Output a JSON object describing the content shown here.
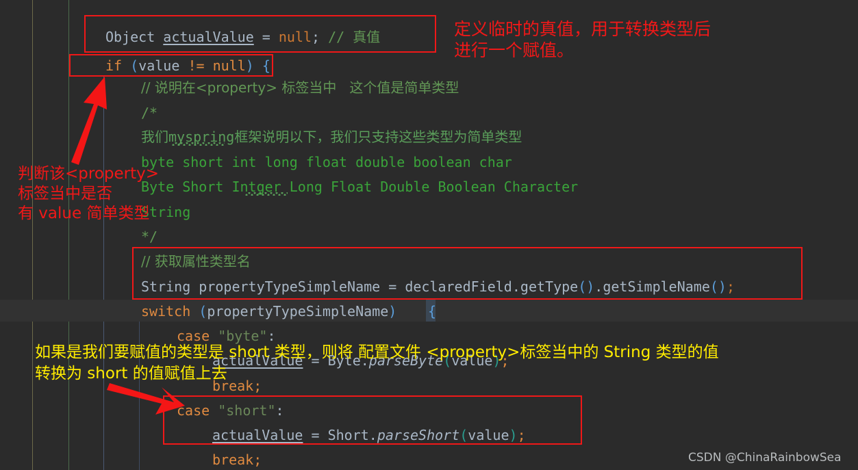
{
  "editor": {
    "background_color": "#2b2b2b",
    "current_line_color": "#323232",
    "code_lines": [
      {
        "id": "l1",
        "text": "Object actualValue = null; // 真值"
      },
      {
        "id": "l2",
        "text": "if (value != null) {"
      },
      {
        "id": "l3",
        "text": "// 说明在<property> 标签当中   这个值是简单类型"
      },
      {
        "id": "l4",
        "text": "/*"
      },
      {
        "id": "l5",
        "text": "我们myspring框架说明以下，我们只支持这些类型为简单类型"
      },
      {
        "id": "l6",
        "text": "byte short int long float double boolean char"
      },
      {
        "id": "l7",
        "text": "Byte Short Intger Long Float Double Boolean Character"
      },
      {
        "id": "l8",
        "text": "String"
      },
      {
        "id": "l9",
        "text": "*/"
      },
      {
        "id": "l10",
        "text": "// 获取属性类型名"
      },
      {
        "id": "l11",
        "text": "String propertyTypeSimpleName = declaredField.getType().getSimpleName();"
      },
      {
        "id": "l12",
        "text": "switch (propertyTypeSimpleName) {"
      },
      {
        "id": "l13",
        "text": "case \"byte\":"
      },
      {
        "id": "l14",
        "text": "actualValue = Byte.parseByte(value);"
      },
      {
        "id": "l15",
        "text": "break;"
      },
      {
        "id": "l16",
        "text": "case \"short\":"
      },
      {
        "id": "l17",
        "text": "actualValue = Short.parseShort(value);"
      },
      {
        "id": "l18",
        "text": "break;"
      }
    ],
    "tokens": {
      "t_object": "Object",
      "t_actualValue": "actualValue",
      "t_eq": " = ",
      "t_null": "null",
      "t_semi": ";",
      "t_comment_zhenzhi": " // 真值",
      "t_if": "if",
      "t_paren_open": " (",
      "t_value": "value",
      "t_neq": " != ",
      "t_paren_close": ")",
      "t_brace_open": " {",
      "t_switch": "switch",
      "t_case": "case",
      "t_str_byte": "\"byte\"",
      "t_str_short": "\"short\"",
      "t_colon": ":",
      "t_break": "break",
      "t_String": "String",
      "t_propTypeSimpleName": " propertyTypeSimpleName",
      "t_declaredField": "declaredField",
      "t_dot": ".",
      "t_getType": "getType",
      "t_parens": "()",
      "t_getSimpleName": "getSimpleName",
      "t_Byte": "Byte",
      "t_parseByte": "parseByte",
      "t_Short": "Short",
      "t_parseShort": "parseShort"
    }
  },
  "annotations": {
    "top_right": {
      "color": "#f01818",
      "line1": "定义临时的真值，用于转换类型后",
      "line2": "进行一个赋值。"
    },
    "left": {
      "color": "#f01818",
      "line1": "判断该<property>",
      "line2": "标签当中是否",
      "line3": "有 value 简单类型"
    },
    "bottom": {
      "color": "#ffec00",
      "line1": "如果是我们要赋值的类型是 short 类型，则将 配置文件 <property>标签当中的 String 类型的值",
      "line2": "转换为 short 的值赋值上去"
    },
    "boxes": [
      {
        "name": "object-actualvalue-box",
        "color": "#f01818"
      },
      {
        "name": "if-value-notnull-box",
        "color": "#f01818"
      },
      {
        "name": "get-property-type-box",
        "color": "#f01818"
      },
      {
        "name": "case-short-box",
        "color": "#f01818"
      }
    ],
    "arrows": [
      {
        "name": "arrow-to-if-statement",
        "color": "#f01818"
      },
      {
        "name": "arrow-to-case-short",
        "color": "#f01818"
      }
    ]
  },
  "watermark": {
    "text": "CSDN @ChinaRainbowSea"
  }
}
